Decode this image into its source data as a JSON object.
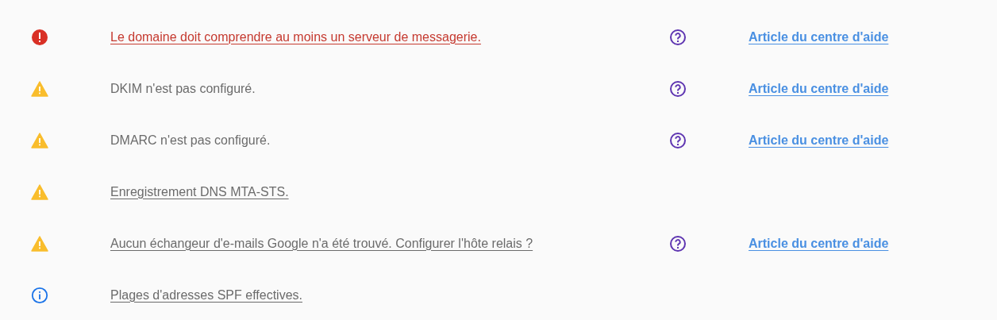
{
  "issues": [
    {
      "kind": "error",
      "message": "Le domaine doit comprendre au moins un serveur de messagerie.",
      "linked": true,
      "help_link": "Article du centre d'aide"
    },
    {
      "kind": "warning",
      "message": "DKIM n'est pas configuré.",
      "linked": false,
      "help_link": "Article du centre d'aide"
    },
    {
      "kind": "warning",
      "message": "DMARC n'est pas configuré.",
      "linked": false,
      "help_link": "Article du centre d'aide"
    },
    {
      "kind": "warning",
      "message": "Enregistrement DNS MTA-STS.",
      "linked": true
    },
    {
      "kind": "warning",
      "message": "Aucun échangeur d'e-mails Google n'a été trouvé. Configurer l'hôte relais ?",
      "linked": true,
      "help_link": "Article du centre d'aide"
    },
    {
      "kind": "info",
      "message": "Plages d'adresses SPF effectives.",
      "linked": true
    }
  ]
}
